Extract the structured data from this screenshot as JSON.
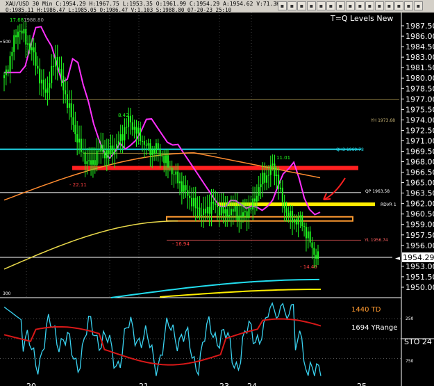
{
  "window": {
    "symbol_line": "XAU/USD 30 Min C:1954.29 H:1967.75 L:1953.35 O:1961.99 C:1954.29 A:1954.62 V:71.3K O:",
    "ohlc_line": "O:1985.11 H:1986.47 L:1985.05 O:1986.47 V:1.103 S:1988.80 07-20-23 25:10",
    "title": "T=Q Levels New"
  },
  "toolbar_icons": [
    "grid-icon",
    "line-icon",
    "chart-icon",
    "pen-icon",
    "bars-icon",
    "candles-icon",
    "target-icon",
    "sheet-icon",
    "trend-icon",
    "circle-icon",
    "arrow-icon",
    "tag-icon",
    "cross-icon",
    "drop-icon",
    "close-icon"
  ],
  "colors": {
    "red_zone": "#ff2020",
    "yellow_zone": "#ffee00",
    "orange_zone": "#ff9a30",
    "cyan": "#22ddee",
    "magenta": "#ff30ff",
    "bars": "#20ff20",
    "white": "#ffffff"
  },
  "price_panel": {
    "y_ticks": [
      "1987.50",
      "1986.00",
      "1984.50",
      "1983.00",
      "1981.50",
      "1980.00",
      "1978.50",
      "1977.00",
      "1975.50",
      "1974.00",
      "1972.50",
      "1971.00",
      "1969.50",
      "1968.00",
      "1966.50",
      "1965.00",
      "1963.50",
      "1962.00",
      "1960.50",
      "1959.00",
      "1957.50",
      "1956.00",
      "1954.29",
      "1953.00",
      "1951.50",
      "1950.00"
    ],
    "current_price": "1954.29",
    "annotations": {
      "high_left": "17.68",
      "high_top": "1988.80",
      "swing_8_42": "8.42",
      "swing_11_01": "11.01",
      "swing_22_11": "- 22.11",
      "swing_16_94": "- 16.94",
      "swing_14_40": "- 14.40",
      "yh": "YH 1973.68",
      "qh3": "QH3 1969.78",
      "qp": "QP 1963.58",
      "rdvr": "RDVR 1",
      "yl": "YL 1956.74",
      "left_500": "500",
      "left_300": "300"
    }
  },
  "chart_data": {
    "type": "candlestick",
    "x_labels": [
      "20",
      "21",
      "23",
      "24",
      "25"
    ],
    "price_ylim": [
      1948.7,
      1988.6
    ],
    "levels": [
      {
        "name": "YH 1973.68",
        "value": 1973.68,
        "color": "#8a7a40"
      },
      {
        "name": "QH3 1969.78",
        "value": 1969.78,
        "color": "#22ddee"
      },
      {
        "name": "QP 1963.58",
        "value": 1963.58,
        "color": "#ffffff"
      },
      {
        "name": "YL 1956.74",
        "value": 1956.74,
        "color": "#aa4040"
      },
      {
        "name": "1954.29",
        "value": 1954.29,
        "color": "#ffffff"
      }
    ],
    "zones": [
      {
        "name": "red",
        "value": 1967.1,
        "color": "#ff2020"
      },
      {
        "name": "yellow",
        "value": 1961.9,
        "color": "#ffee00"
      },
      {
        "name": "orange",
        "value": 1959.8,
        "color": "#ff9a30"
      }
    ],
    "close_path": [
      1980,
      1982,
      1985,
      1987,
      1986.5,
      1985,
      1984,
      1982,
      1979,
      1978,
      1980,
      1983,
      1981,
      1978,
      1976,
      1973,
      1971,
      1969,
      1968,
      1967.5,
      1969,
      1970,
      1969,
      1969.5,
      1970,
      1971,
      1972.5,
      1974,
      1973,
      1972,
      1971,
      1970,
      1969.5,
      1970,
      1969,
      1968,
      1967,
      1966,
      1965,
      1964,
      1963,
      1962,
      1961,
      1960.5,
      1961,
      1962,
      1961.5,
      1961,
      1960.5,
      1960.8,
      1961,
      1960,
      1960.5,
      1961,
      1962,
      1964,
      1965.5,
      1966,
      1967.5,
      1966,
      1963,
      1961,
      1960,
      1959.5,
      1960,
      1958.5,
      1957,
      1955,
      1954.29
    ],
    "indicator_labels": {
      "td": "1440 TD",
      "yrange": "1694 YRange",
      "sto": "STO 24",
      "sto_250": "250",
      "sto_750": "750"
    }
  }
}
